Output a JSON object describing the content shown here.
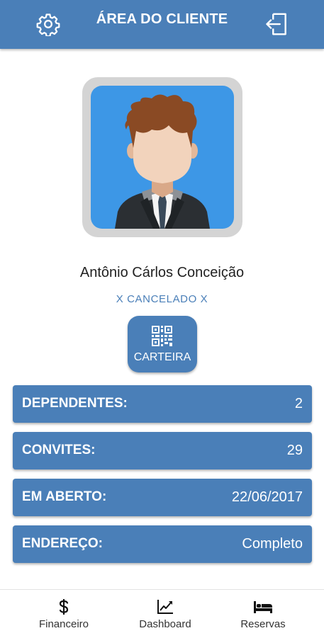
{
  "header": {
    "title": "ÁREA DO CLIENTE",
    "left_icon": "settings-gear-icon",
    "right_icon": "logout-icon"
  },
  "profile": {
    "name": "Antônio Cárlos Conceição",
    "status": "X CANCELADO X",
    "avatar": "person-avatar-illustration"
  },
  "wallet_button": {
    "label": "CARTEIRA",
    "icon": "qr-code-icon"
  },
  "info_rows": [
    {
      "label": "DEPENDENTES:",
      "value": "2"
    },
    {
      "label": "CONVITES:",
      "value": "29"
    },
    {
      "label": "EM ABERTO:",
      "value": "22/06/2017"
    },
    {
      "label": "ENDEREÇO:",
      "value": "Completo"
    }
  ],
  "bottom_nav": [
    {
      "label": "Financeiro",
      "icon": "dollar-icon"
    },
    {
      "label": "Dashboard",
      "icon": "chart-line-icon"
    },
    {
      "label": "Reservas",
      "icon": "bed-icon"
    }
  ],
  "colors": {
    "primary": "#4a7fb8",
    "avatar_background": "#3d97e6",
    "avatar_frame": "#d4d4d4"
  }
}
